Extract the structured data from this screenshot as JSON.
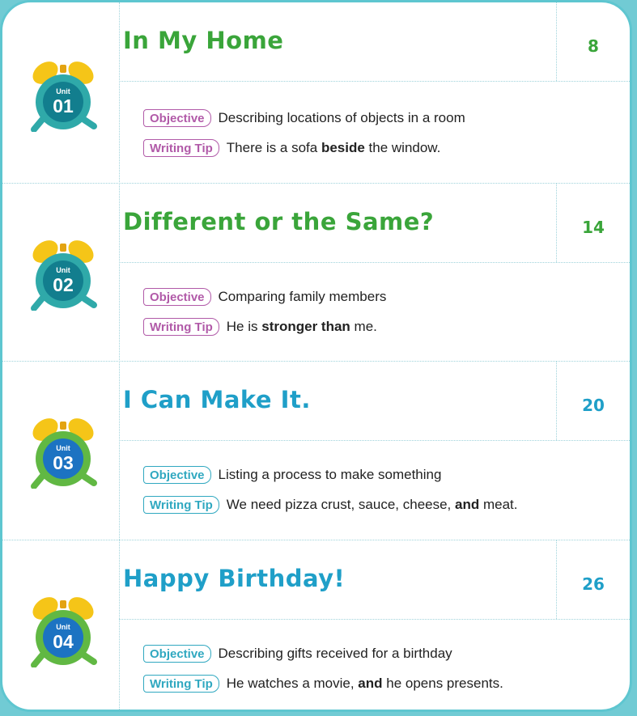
{
  "colors": {
    "frame": "#5ec6d0",
    "green_title": "#3aa53a",
    "blue_title": "#1f9fc8",
    "purple_badge": "#b15aa8",
    "teal_badge": "#30a8c0",
    "clock_bells": "#f5c518",
    "clock_teal": "#2fa9a9",
    "clock_green": "#61b843",
    "clock_face_teal": "#127e8e",
    "clock_face_blue": "#1c73c2"
  },
  "units": [
    {
      "badge_word": "Unit",
      "badge_number": "01",
      "title": "In My Home",
      "page": "8",
      "objective_label": "Objective",
      "objective_text": "Describing locations of objects in a room",
      "tip_label": "Writing Tip",
      "tip_before": "There is a sofa ",
      "tip_bold": "beside",
      "tip_after": " the window.",
      "icon": "alarm-clock-icon"
    },
    {
      "badge_word": "Unit",
      "badge_number": "02",
      "title": "Different or the Same?",
      "page": "14",
      "objective_label": "Objective",
      "objective_text": "Comparing family members",
      "tip_label": "Writing Tip",
      "tip_before": "He is ",
      "tip_bold": "stronger than",
      "tip_after": " me.",
      "icon": "alarm-clock-icon"
    },
    {
      "badge_word": "Unit",
      "badge_number": "03",
      "title": "I Can Make It.",
      "page": "20",
      "objective_label": "Objective",
      "objective_text": "Listing a process to make something",
      "tip_label": "Writing Tip",
      "tip_before": "We need pizza crust, sauce, cheese, ",
      "tip_bold": "and",
      "tip_after": " meat.",
      "icon": "alarm-clock-icon"
    },
    {
      "badge_word": "Unit",
      "badge_number": "04",
      "title": "Happy Birthday!",
      "page": "26",
      "objective_label": "Objective",
      "objective_text": "Describing gifts received for a birthday",
      "tip_label": "Writing Tip",
      "tip_before": "He watches a movie, ",
      "tip_bold": "and",
      "tip_after": " he opens presents.",
      "icon": "alarm-clock-icon"
    }
  ]
}
